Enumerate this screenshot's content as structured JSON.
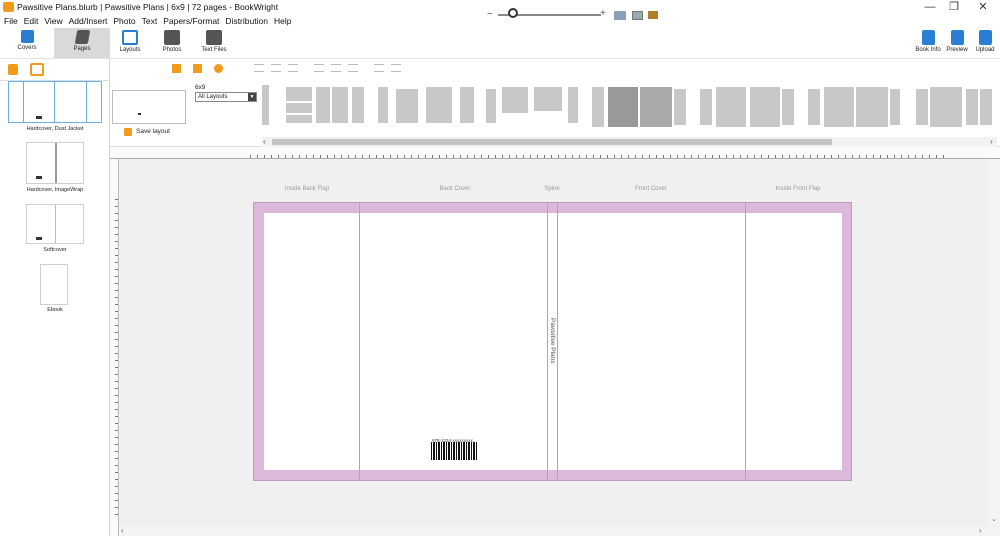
{
  "window": {
    "title": "Pawsitive Plans.blurb | Pawsitive Plans | 6x9 | 72 pages - BookWright",
    "minimize": "—",
    "restore": "❐",
    "close": "✕"
  },
  "menu": [
    "File",
    "Edit",
    "View",
    "Add/Insert",
    "Photo",
    "Text",
    "Papers/Format",
    "Distribution",
    "Help"
  ],
  "toolbar": {
    "covers": "Covers",
    "pages": "Pages",
    "layouts": "Layouts",
    "photos": "Photos",
    "text_files": "Text Files",
    "book_info": "Book Info",
    "preview": "Preview",
    "upload": "Upload",
    "zoom_minus": "−",
    "zoom_plus": "+"
  },
  "covers_panel": {
    "items": [
      {
        "label": "Hardcover, Dust Jacket"
      },
      {
        "label": "Hardcover, ImageWrap"
      },
      {
        "label": "Softcover"
      },
      {
        "label": "Ebook"
      }
    ]
  },
  "layouts_panel": {
    "size": "6x9",
    "filter": "All Layouts",
    "save_label": "Save layout"
  },
  "cover_sections": {
    "inside_back_flap": "Inside Back Flap",
    "back_cover": "Back Cover",
    "spine": "Spine",
    "front_cover": "Front Cover",
    "inside_front_flap": "Inside Front Flap"
  },
  "spine_text": "Pawsitive Plans",
  "isbn_text": "978-1234-xxxxxxxxx",
  "colors": {
    "accent": "#f29a1e",
    "cover_bleed": "#dcb8da",
    "canvas_bg": "#f0f0f0"
  }
}
